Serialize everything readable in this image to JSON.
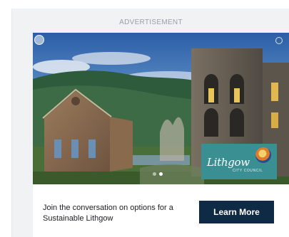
{
  "ad": {
    "label": "ADVERTISEMENT",
    "copy": "Join the conversation on options for a Sustainable Lithgow",
    "cta_label": "Learn More",
    "logo": {
      "name": "Lithgow",
      "subtitle": "CITY COUNCIL"
    },
    "carousel": {
      "slides": 2,
      "active": 2
    },
    "colors": {
      "cta_background": "#0f2a44",
      "logo_background": "#3a8f92",
      "frame_background": "#f1f2f4"
    }
  }
}
